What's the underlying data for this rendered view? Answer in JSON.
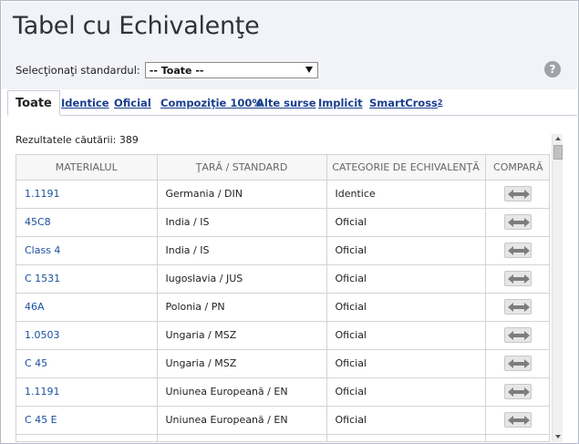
{
  "page": {
    "title": "Tabel cu Echivalenţe",
    "standard_label": "Selecţionaţi standardul:",
    "standard_value": "-- Toate --",
    "help_icon": "?"
  },
  "tabs": [
    {
      "label": "Toate",
      "active": true
    },
    {
      "label": "Identice",
      "active": false
    },
    {
      "label": "Oficial",
      "active": false
    },
    {
      "label": "Compoziţie 100%",
      "active": false
    },
    {
      "label": "Alte surse",
      "active": false
    },
    {
      "label": "Implicit",
      "active": false
    },
    {
      "label": "SmartCross",
      "sup": "2",
      "active": false
    }
  ],
  "results_text": "Rezultatele căutării: 389",
  "table": {
    "headers": [
      "MATERIALUL",
      "ŢARĂ / STANDARD",
      "CATEGORIE DE ECHIVALENŢĂ",
      "COMPARĂ"
    ],
    "rows": [
      {
        "material": "1.1191",
        "country": "Germania / DIN",
        "category": "Identice"
      },
      {
        "material": "45C8",
        "country": "India / IS",
        "category": "Oficial"
      },
      {
        "material": "Class 4",
        "country": "India / IS",
        "category": "Oficial"
      },
      {
        "material": "C 1531",
        "country": "Iugoslavia / JUS",
        "category": "Oficial"
      },
      {
        "material": "46A",
        "country": "Polonia / PN",
        "category": "Oficial"
      },
      {
        "material": "1.0503",
        "country": "Ungaria / MSZ",
        "category": "Oficial"
      },
      {
        "material": "C 45",
        "country": "Ungaria / MSZ",
        "category": "Oficial"
      },
      {
        "material": "1.1191",
        "country": "Uniunea Europeană / EN",
        "category": "Oficial"
      },
      {
        "material": "C 45 E",
        "country": "Uniunea Europeană / EN",
        "category": "Oficial"
      },
      {
        "material": "",
        "country": "",
        "category": ""
      }
    ]
  },
  "icons": {
    "compare": "compare-arrows-icon",
    "help": "help-icon",
    "dropdown": "chevron-down-icon"
  }
}
